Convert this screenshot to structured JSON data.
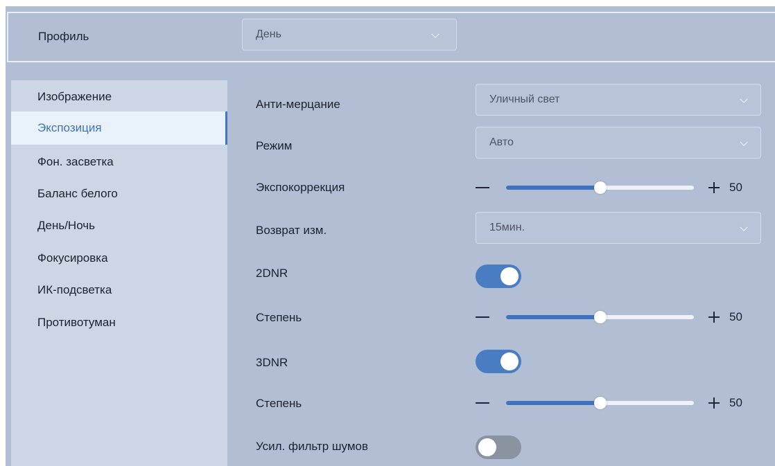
{
  "profile": {
    "label": "Профиль",
    "selected": "День"
  },
  "sidebar": {
    "items": [
      {
        "label": "Изображение",
        "active": false
      },
      {
        "label": "Экспозиция",
        "active": true
      },
      {
        "label": "Фон. засветка",
        "active": false
      },
      {
        "label": "Баланс белого",
        "active": false
      },
      {
        "label": "День/Ночь",
        "active": false
      },
      {
        "label": "Фокусировка",
        "active": false
      },
      {
        "label": "ИК-подсветка",
        "active": false
      },
      {
        "label": "Противотуман",
        "active": false
      }
    ]
  },
  "settings": {
    "anti_flicker": {
      "label": "Анти-мерцание",
      "value": "Уличный свет"
    },
    "mode": {
      "label": "Режим",
      "value": "Авто"
    },
    "exposure_comp": {
      "label": "Экспокоррекция",
      "value": 50,
      "value_text": "50",
      "max": 100
    },
    "revert": {
      "label": "Возврат изм.",
      "value": "15мин."
    },
    "dnr2": {
      "label": "2DNR",
      "enabled": true
    },
    "dnr2_level": {
      "label": "Степень",
      "value": 50,
      "value_text": "50",
      "max": 100
    },
    "dnr3": {
      "label": "3DNR",
      "enabled": true
    },
    "dnr3_level": {
      "label": "Степень",
      "value": 50,
      "value_text": "50",
      "max": 100
    },
    "noise_filter": {
      "label": "Усил. фильтр шумов",
      "enabled": false
    }
  },
  "colors": {
    "accent": "#3f73bd",
    "panel_bg": "#b1bed3",
    "sidebar_bg": "#cdd6e4",
    "active_item_bg": "#e9f1fb"
  }
}
